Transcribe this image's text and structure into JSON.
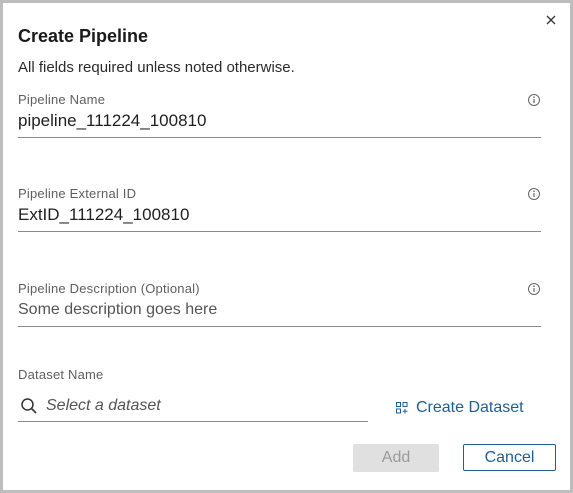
{
  "dialog": {
    "title": "Create Pipeline",
    "subtitle": "All fields required unless noted otherwise."
  },
  "fields": {
    "pipeline_name": {
      "label": "Pipeline Name",
      "value": "pipeline_111224_100810"
    },
    "external_id": {
      "label": "Pipeline External ID",
      "value": "ExtID_111224_100810"
    },
    "description": {
      "label": "Pipeline Description (Optional)",
      "placeholder": "Some description goes here"
    },
    "dataset": {
      "label": "Dataset Name",
      "placeholder": "Select a dataset"
    }
  },
  "actions": {
    "create_dataset_label": "Create Dataset",
    "add_label": "Add",
    "cancel_label": "Cancel"
  },
  "colors": {
    "accent": "#1f5f94",
    "disabled_bg": "#e0e0e0",
    "disabled_text": "#9a9a9a"
  },
  "icons": [
    "close-icon",
    "info-icon",
    "search-icon",
    "dataset-grid-icon"
  ]
}
